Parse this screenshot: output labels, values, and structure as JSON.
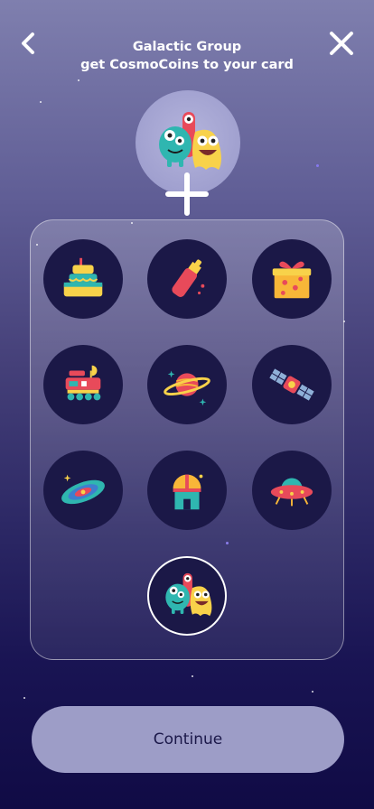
{
  "header": {
    "title": "Galactic Group",
    "subtitle": "get CosmoCoins to your card"
  },
  "selected_avatar": "alien-monsters-icon",
  "avatars": [
    "birthday-cake-icon",
    "sauce-bottle-icon",
    "gift-box-icon",
    "moon-rover-icon",
    "planet-icon",
    "satellite-icon",
    "galaxy-icon",
    "observatory-icon",
    "ufo-icon",
    "alien-monsters-icon"
  ],
  "continue_label": "Continue",
  "colors": {
    "background_top": "#7f7fae",
    "background_bottom": "#100b45",
    "option_circle": "#1b1847",
    "button_bg": "#9d9dc7",
    "button_text": "#1b1849"
  }
}
